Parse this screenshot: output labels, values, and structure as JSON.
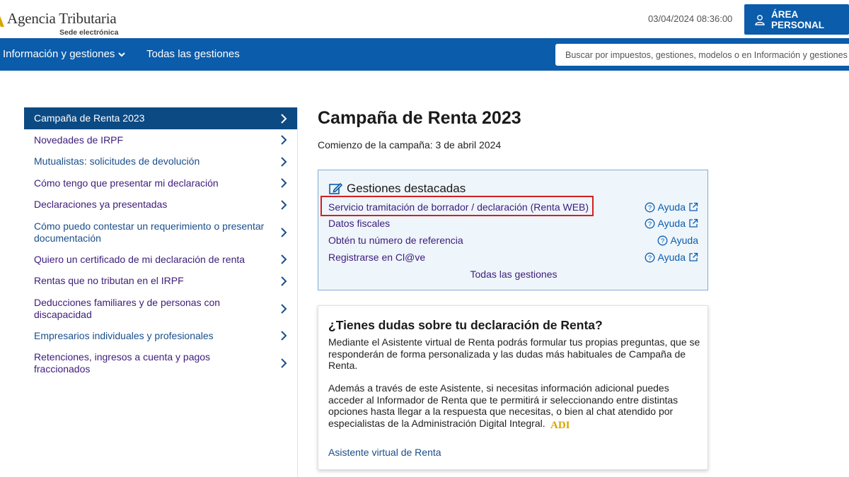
{
  "header": {
    "logo_title": "Agencia Tributaria",
    "logo_subtitle": "Sede electrónica",
    "datetime": "03/04/2024 08:36:00",
    "area_personal": "ÁREA PERSONAL"
  },
  "nav": {
    "info_gestiones": "Información y gestiones",
    "todas_gestiones": "Todas las gestiones",
    "search_placeholder": "Buscar por impuestos, gestiones, modelos o en Información y gestiones"
  },
  "sidebar": {
    "items": [
      {
        "label": "Campaña de Renta 2023",
        "active": true
      },
      {
        "label": "Novedades de IRPF"
      },
      {
        "label": "Mutualistas: solicitudes de devolución"
      },
      {
        "label": "Cómo tengo que presentar mi declaración"
      },
      {
        "label": "Declaraciones ya presentadas"
      },
      {
        "label": "Cómo puedo contestar un requerimiento o presentar documentación"
      },
      {
        "label": "Quiero un certificado de mi declaración de renta"
      },
      {
        "label": "Rentas que no tributan en el IRPF"
      },
      {
        "label": "Deducciones familiares y de personas con discapacidad"
      },
      {
        "label": "Empresarios individuales y profesionales"
      },
      {
        "label": "Retenciones, ingresos a cuenta y pagos fraccionados"
      }
    ]
  },
  "main": {
    "title": "Campaña de Renta 2023",
    "start": "Comienzo de la campaña: 3 de abril 2024",
    "gestiones": {
      "title": "Gestiones destacadas",
      "rows": [
        {
          "link": "Servicio tramitación de borrador / declaración (Renta WEB)",
          "ayuda": "Ayuda"
        },
        {
          "link": "Datos fiscales",
          "ayuda": "Ayuda"
        },
        {
          "link": "Obtén tu número de referencia",
          "ayuda": "Ayuda"
        },
        {
          "link": "Registrarse en Cl@ve",
          "ayuda": "Ayuda"
        }
      ],
      "todas": "Todas las gestiones"
    },
    "dudas": {
      "title": "¿Tienes dudas sobre tu declaración de Renta?",
      "p1": "Mediante el Asistente virtual de Renta podrás formular tus propias preguntas, que se responderán de forma personalizada y las dudas más habituales de Campaña de Renta.",
      "p2": "Además a través de este Asistente, si necesitas información adicional puedes acceder al Informador de Renta que te permitirá ir seleccionando entre distintas opciones hasta llegar a la respuesta que necesitas, o bien al chat atendido por especialistas de la Administración Digital Integral.",
      "adi_logo": "ADI",
      "link": "Asistente virtual de Renta"
    }
  },
  "colors": {
    "brand_blue": "#0b5cab",
    "active_side": "#0c4a84",
    "link_purple": "#3d1c7a",
    "highlight_red": "#d42020"
  }
}
